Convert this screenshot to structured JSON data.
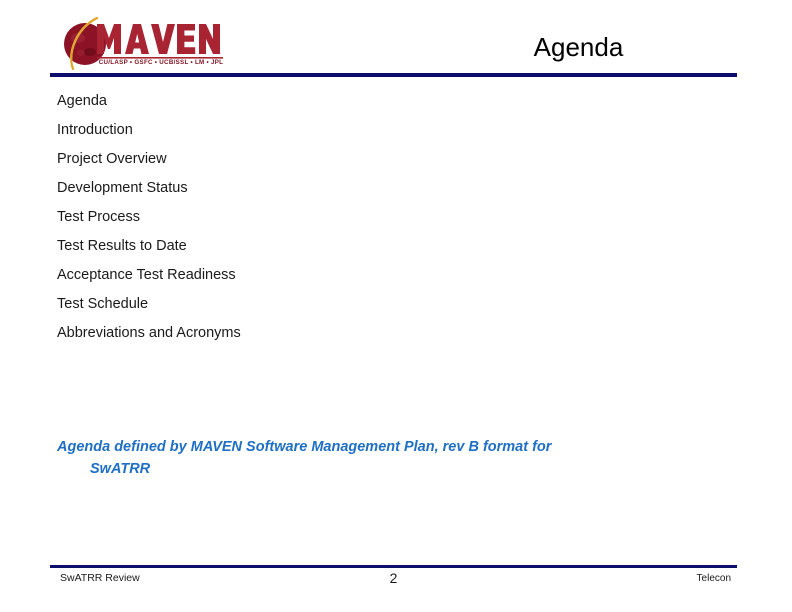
{
  "header": {
    "title": "Agenda",
    "logo": {
      "wordmark": "MAVEN",
      "partners": "CU/LASP • GSFC • UCB/SSL • LM • JPL",
      "planet_color": "#8c1226",
      "planet_shade": "#5d0a18",
      "orbit_color": "#e8b23a",
      "wordmark_color": "#a82432"
    },
    "rule_color": "#0d0d6b"
  },
  "main": {
    "agenda_items": [
      "Agenda",
      "Introduction",
      "Project Overview",
      "Development Status",
      "Test Process",
      "Test Results to Date",
      "Acceptance Test Readiness",
      "Test Schedule",
      "Abbreviations and Acronyms"
    ],
    "note": {
      "line1": "Agenda defined by MAVEN Software Management Plan, rev B format for",
      "line2": "SwATRR",
      "color": "#1f6fc4"
    }
  },
  "footer": {
    "left": "SwATRR Review",
    "page_number": "2",
    "right": "Telecon",
    "rule_color": "#0d0d6b"
  }
}
